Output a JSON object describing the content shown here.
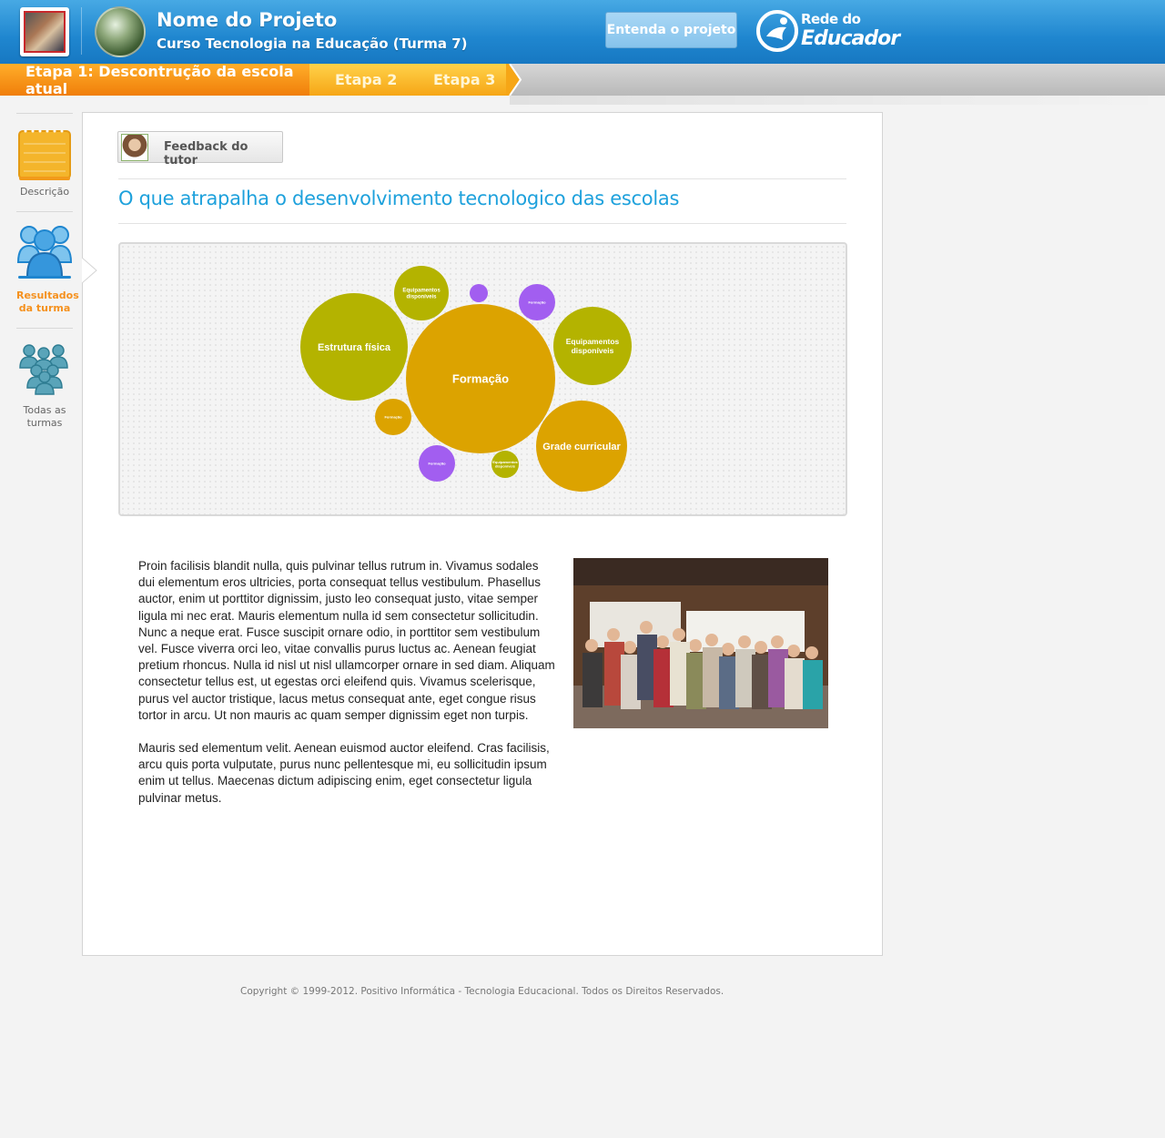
{
  "header": {
    "project_title": "Nome do Projeto",
    "project_subtitle": "Curso Tecnologia na Educação (Turma 7)",
    "about_button": "Entenda o projeto",
    "brand_top": "Rede do",
    "brand_bottom": "Educador"
  },
  "steps": [
    {
      "label": "Etapa 1: Descontrução da escola atual",
      "active": true
    },
    {
      "label": "Etapa 2",
      "active": false
    },
    {
      "label": "Etapa 3",
      "active": false
    }
  ],
  "nav": [
    {
      "label": "Descrição",
      "icon": "notepad-icon",
      "active": false
    },
    {
      "label": "Resultados da turma",
      "icon": "class-group-icon",
      "active": true
    },
    {
      "label": "Todas as turmas",
      "icon": "all-classes-icon",
      "active": false
    }
  ],
  "feedback_button": "Feedback do tutor",
  "page_title": "O que atrapalha o desenvolvimento tecnologico das escolas",
  "chart_data": {
    "type": "bubble",
    "colors": {
      "olive": "#b4b300",
      "gold": "#dca300",
      "purple": "#a25ef0"
    },
    "bubbles": [
      {
        "label": "Formação",
        "size": 82,
        "color": "gold"
      },
      {
        "label": "Estrutura física",
        "size": 59,
        "color": "olive"
      },
      {
        "label": "Grade curricular",
        "size": 50,
        "color": "gold"
      },
      {
        "label": "Equipamentos disponíveis",
        "size": 43,
        "color": "olive"
      },
      {
        "label": "Equipamentos disponíveis",
        "size": 30,
        "color": "olive"
      },
      {
        "label": "Formação",
        "size": 20,
        "color": "gold"
      },
      {
        "label": "Formação",
        "size": 20,
        "color": "purple"
      },
      {
        "label": "Formação",
        "size": 20,
        "color": "purple"
      },
      {
        "label": "Equipamentos disponíveis",
        "size": 15,
        "color": "olive"
      },
      {
        "label": "",
        "size": 10,
        "color": "purple"
      }
    ]
  },
  "body": {
    "paragraph_1": "Proin facilisis blandit nulla, quis pulvinar tellus rutrum in. Vivamus sodales dui elementum eros ultricies, porta consequat tellus vestibulum. Phasellus auctor, enim ut porttitor dignissim, justo leo consequat justo, vitae semper ligula mi nec erat. Mauris elementum nulla id sem consectetur sollicitudin. Nunc a neque erat. Fusce suscipit ornare odio, in porttitor sem vestibulum vel. Fusce viverra orci leo, vitae convallis purus luctus ac. Aenean feugiat pretium rhoncus. Nulla id nisl ut nisl ullamcorper ornare in sed diam. Aliquam consectetur tellus est, ut egestas orci eleifend quis. Vivamus scelerisque, purus vel auctor tristique, lacus metus consequat ante, eget congue risus tortor in arcu. Ut non mauris ac quam semper dignissim eget non turpis.",
    "paragraph_2": "Mauris sed elementum velit. Aenean euismod auctor eleifend. Cras facilisis, arcu quis porta vulputate, purus nunc pellentesque mi, eu sollicitudin ipsum enim ut tellus. Maecenas dictum adipiscing enim, eget consectetur ligula pulvinar metus."
  },
  "footer": "Copyright © 1999-2012.  Positivo Informática - Tecnologia Educacional. Todos os Direitos Reservados."
}
